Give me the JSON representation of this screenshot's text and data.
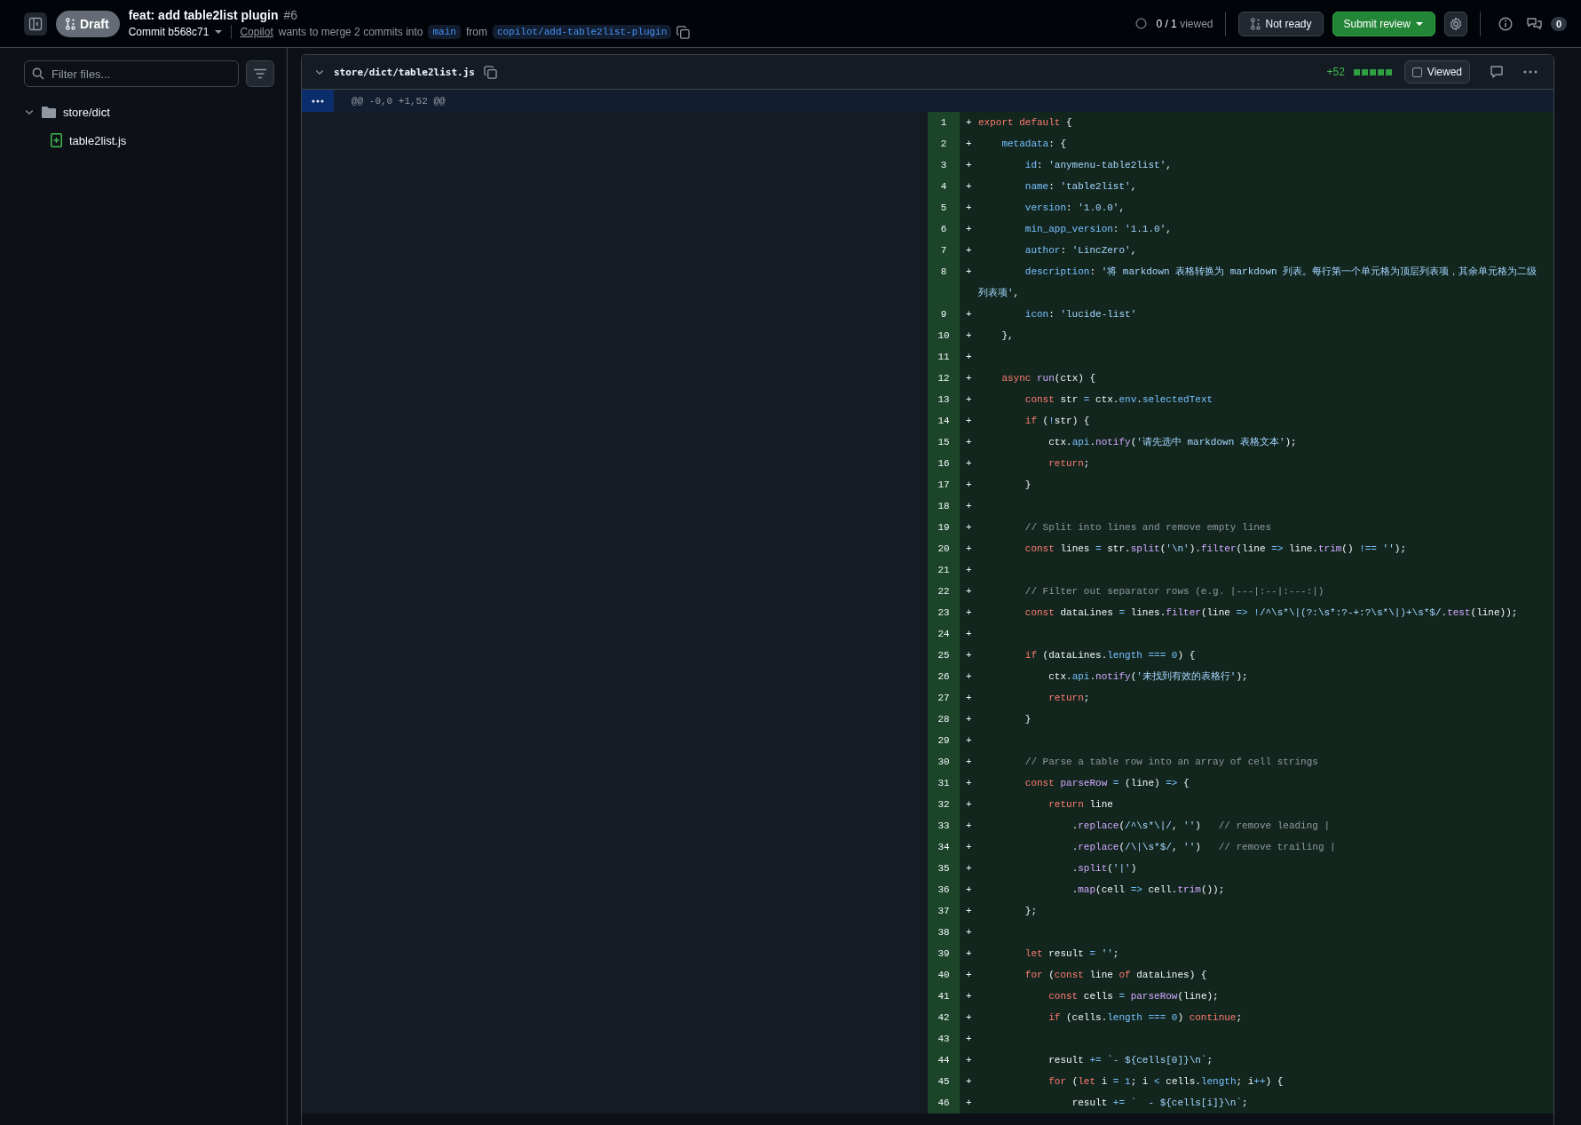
{
  "header": {
    "draft_label": "Draft",
    "title": "feat: add table2list plugin",
    "number": "#6",
    "commit": "Commit b568c71",
    "author": "Copilot",
    "merge_text": "wants to merge 2 commits into",
    "base_branch": "main",
    "from_text": "from",
    "head_branch": "copilot/add-table2list-plugin",
    "viewed_count": "0 / 1",
    "viewed_label": "viewed",
    "ready_button": "Not ready",
    "submit_button": "Submit review",
    "comment_count": "0"
  },
  "sidebar": {
    "filter": {
      "placeholder": "Filter files..."
    },
    "tree": [
      {
        "name": "store/dict",
        "kind": "folder",
        "expanded": true,
        "children": [
          {
            "name": "table2list.js",
            "kind": "added-file"
          }
        ]
      }
    ]
  },
  "file": {
    "path": "store/dict/table2list.js",
    "expanded": true,
    "additions": "+52",
    "viewed": {
      "label": "Viewed",
      "checked": false
    },
    "hunk": "@@ -0,0 +1,52 @@",
    "lines": [
      {
        "number": "1",
        "sign": "+",
        "tokens": [
          {
            "kind": "keyword",
            "text": "export default"
          },
          {
            "kind": "plain",
            "text": " {"
          }
        ]
      },
      {
        "number": "2",
        "sign": "+",
        "tokens": [
          {
            "kind": "property",
            "text": "    metadata"
          },
          {
            "kind": "plain",
            "text": ": {"
          }
        ]
      },
      {
        "number": "3",
        "sign": "+",
        "tokens": [
          {
            "kind": "property",
            "text": "        id"
          },
          {
            "kind": "plain",
            "text": ": "
          },
          {
            "kind": "string",
            "text": "'anymenu-table2list'"
          },
          {
            "kind": "plain",
            "text": ","
          }
        ]
      },
      {
        "number": "4",
        "sign": "+",
        "tokens": [
          {
            "kind": "property",
            "text": "        name"
          },
          {
            "kind": "plain",
            "text": ": "
          },
          {
            "kind": "string",
            "text": "'table2list'"
          },
          {
            "kind": "plain",
            "text": ","
          }
        ]
      },
      {
        "number": "5",
        "sign": "+",
        "tokens": [
          {
            "kind": "property",
            "text": "        version"
          },
          {
            "kind": "plain",
            "text": ": "
          },
          {
            "kind": "string",
            "text": "'1.0.0'"
          },
          {
            "kind": "plain",
            "text": ","
          }
        ]
      },
      {
        "number": "6",
        "sign": "+",
        "tokens": [
          {
            "kind": "property",
            "text": "        min_app_version"
          },
          {
            "kind": "plain",
            "text": ": "
          },
          {
            "kind": "string",
            "text": "'1.1.0'"
          },
          {
            "kind": "plain",
            "text": ","
          }
        ]
      },
      {
        "number": "7",
        "sign": "+",
        "tokens": [
          {
            "kind": "property",
            "text": "        author"
          },
          {
            "kind": "plain",
            "text": ": "
          },
          {
            "kind": "string",
            "text": "'LincZero'"
          },
          {
            "kind": "plain",
            "text": ","
          }
        ]
      },
      {
        "number": "8",
        "sign": "+",
        "tokens": [
          {
            "kind": "property",
            "text": "        description"
          },
          {
            "kind": "plain",
            "text": ": "
          },
          {
            "kind": "string",
            "text": "'将 markdown 表格转换为 markdown 列表。每行第一个单元格为顶层列表项，其余单元格为二级列表项'"
          },
          {
            "kind": "plain",
            "text": ","
          }
        ]
      },
      {
        "number": "9",
        "sign": "+",
        "tokens": [
          {
            "kind": "property",
            "text": "        icon"
          },
          {
            "kind": "plain",
            "text": ": "
          },
          {
            "kind": "string",
            "text": "'lucide-list'"
          }
        ]
      },
      {
        "number": "10",
        "sign": "+",
        "tokens": [
          {
            "kind": "plain",
            "text": "    },"
          }
        ]
      },
      {
        "number": "11",
        "sign": "+"
      },
      {
        "number": "12",
        "sign": "+",
        "tokens": [
          {
            "kind": "keyword",
            "text": "    async"
          },
          {
            "kind": "function",
            "text": " run"
          },
          {
            "kind": "plain",
            "text": "(ctx) {"
          }
        ]
      },
      {
        "number": "13",
        "sign": "+",
        "tokens": [
          {
            "kind": "keyword",
            "text": "        const"
          },
          {
            "kind": "plain",
            "text": " str "
          },
          {
            "kind": "property",
            "text": "="
          },
          {
            "kind": "plain",
            "text": " ctx."
          },
          {
            "kind": "property",
            "text": "env"
          },
          {
            "kind": "plain",
            "text": "."
          },
          {
            "kind": "property",
            "text": "selectedText"
          }
        ]
      },
      {
        "number": "14",
        "sign": "+",
        "tokens": [
          {
            "kind": "keyword",
            "text": "        if"
          },
          {
            "kind": "plain",
            "text": " ("
          },
          {
            "kind": "property",
            "text": "!"
          },
          {
            "kind": "plain",
            "text": "str) {"
          }
        ]
      },
      {
        "number": "15",
        "sign": "+",
        "tokens": [
          {
            "kind": "plain",
            "text": "            ctx."
          },
          {
            "kind": "property",
            "text": "api"
          },
          {
            "kind": "plain",
            "text": "."
          },
          {
            "kind": "function",
            "text": "notify"
          },
          {
            "kind": "plain",
            "text": "("
          },
          {
            "kind": "string",
            "text": "'请先选中 markdown 表格文本'"
          },
          {
            "kind": "plain",
            "text": ");"
          }
        ]
      },
      {
        "number": "16",
        "sign": "+",
        "tokens": [
          {
            "kind": "keyword",
            "text": "            return"
          },
          {
            "kind": "plain",
            "text": ";"
          }
        ]
      },
      {
        "number": "17",
        "sign": "+",
        "tokens": [
          {
            "kind": "plain",
            "text": "        }"
          }
        ]
      },
      {
        "number": "18",
        "sign": "+"
      },
      {
        "number": "19",
        "sign": "+",
        "tokens": [
          {
            "kind": "comment",
            "text": "        // Split into lines and remove empty lines"
          }
        ]
      },
      {
        "number": "20",
        "sign": "+",
        "tokens": [
          {
            "kind": "keyword",
            "text": "        const"
          },
          {
            "kind": "plain",
            "text": " lines "
          },
          {
            "kind": "property",
            "text": "="
          },
          {
            "kind": "plain",
            "text": " str."
          },
          {
            "kind": "function",
            "text": "split"
          },
          {
            "kind": "plain",
            "text": "("
          },
          {
            "kind": "string",
            "text": "'\\n'"
          },
          {
            "kind": "plain",
            "text": ")."
          },
          {
            "kind": "function",
            "text": "filter"
          },
          {
            "kind": "plain",
            "text": "(line "
          },
          {
            "kind": "property",
            "text": "=>"
          },
          {
            "kind": "plain",
            "text": " line."
          },
          {
            "kind": "function",
            "text": "trim"
          },
          {
            "kind": "plain",
            "text": "() "
          },
          {
            "kind": "property",
            "text": "!=="
          },
          {
            "kind": "string",
            "text": " ''"
          },
          {
            "kind": "plain",
            "text": ");"
          }
        ]
      },
      {
        "number": "21",
        "sign": "+"
      },
      {
        "number": "22",
        "sign": "+",
        "tokens": [
          {
            "kind": "comment",
            "text": "        // Filter out separator rows (e.g. |---|:--|:---:|)"
          }
        ]
      },
      {
        "number": "23",
        "sign": "+",
        "tokens": [
          {
            "kind": "keyword",
            "text": "        const"
          },
          {
            "kind": "plain",
            "text": " dataLines "
          },
          {
            "kind": "property",
            "text": "="
          },
          {
            "kind": "plain",
            "text": " lines."
          },
          {
            "kind": "function",
            "text": "filter"
          },
          {
            "kind": "plain",
            "text": "(line "
          },
          {
            "kind": "property",
            "text": "=>"
          },
          {
            "kind": "property",
            "text": " !"
          },
          {
            "kind": "string",
            "text": "/^\\s*\\|(?:\\s*:?-+:?\\s*\\|)+\\s*$/"
          },
          {
            "kind": "plain",
            "text": "."
          },
          {
            "kind": "function",
            "text": "test"
          },
          {
            "kind": "plain",
            "text": "(line));"
          }
        ]
      },
      {
        "number": "24",
        "sign": "+"
      },
      {
        "number": "25",
        "sign": "+",
        "tokens": [
          {
            "kind": "keyword",
            "text": "        if"
          },
          {
            "kind": "plain",
            "text": " (dataLines."
          },
          {
            "kind": "property",
            "text": "length"
          },
          {
            "kind": "property",
            "text": " ==="
          },
          {
            "kind": "property",
            "text": " 0"
          },
          {
            "kind": "plain",
            "text": ") {"
          }
        ]
      },
      {
        "number": "26",
        "sign": "+",
        "tokens": [
          {
            "kind": "plain",
            "text": "            ctx."
          },
          {
            "kind": "property",
            "text": "api"
          },
          {
            "kind": "plain",
            "text": "."
          },
          {
            "kind": "function",
            "text": "notify"
          },
          {
            "kind": "plain",
            "text": "("
          },
          {
            "kind": "string",
            "text": "'未找到有效的表格行'"
          },
          {
            "kind": "plain",
            "text": ");"
          }
        ]
      },
      {
        "number": "27",
        "sign": "+",
        "tokens": [
          {
            "kind": "keyword",
            "text": "            return"
          },
          {
            "kind": "plain",
            "text": ";"
          }
        ]
      },
      {
        "number": "28",
        "sign": "+",
        "tokens": [
          {
            "kind": "plain",
            "text": "        }"
          }
        ]
      },
      {
        "number": "29",
        "sign": "+"
      },
      {
        "number": "30",
        "sign": "+",
        "tokens": [
          {
            "kind": "comment",
            "text": "        // Parse a table row into an array of cell strings"
          }
        ]
      },
      {
        "number": "31",
        "sign": "+",
        "tokens": [
          {
            "kind": "keyword",
            "text": "        const"
          },
          {
            "kind": "function",
            "text": " parseRow"
          },
          {
            "kind": "property",
            "text": " ="
          },
          {
            "kind": "plain",
            "text": " (line) "
          },
          {
            "kind": "property",
            "text": "=>"
          },
          {
            "kind": "plain",
            "text": " {"
          }
        ]
      },
      {
        "number": "32",
        "sign": "+",
        "tokens": [
          {
            "kind": "keyword",
            "text": "            return"
          },
          {
            "kind": "plain",
            "text": " line"
          }
        ]
      },
      {
        "number": "33",
        "sign": "+",
        "tokens": [
          {
            "kind": "plain",
            "text": "                ."
          },
          {
            "kind": "function",
            "text": "replace"
          },
          {
            "kind": "plain",
            "text": "("
          },
          {
            "kind": "string",
            "text": "/^\\s*\\|/"
          },
          {
            "kind": "plain",
            "text": ", "
          },
          {
            "kind": "string",
            "text": "''"
          },
          {
            "kind": "plain",
            "text": ")"
          },
          {
            "kind": "comment",
            "text": "   // remove leading |"
          }
        ]
      },
      {
        "number": "34",
        "sign": "+",
        "tokens": [
          {
            "kind": "plain",
            "text": "                ."
          },
          {
            "kind": "function",
            "text": "replace"
          },
          {
            "kind": "plain",
            "text": "("
          },
          {
            "kind": "string",
            "text": "/\\|\\s*$/"
          },
          {
            "kind": "plain",
            "text": ", "
          },
          {
            "kind": "string",
            "text": "''"
          },
          {
            "kind": "plain",
            "text": ")"
          },
          {
            "kind": "comment",
            "text": "   // remove trailing |"
          }
        ]
      },
      {
        "number": "35",
        "sign": "+",
        "tokens": [
          {
            "kind": "plain",
            "text": "                ."
          },
          {
            "kind": "function",
            "text": "split"
          },
          {
            "kind": "plain",
            "text": "("
          },
          {
            "kind": "string",
            "text": "'|'"
          },
          {
            "kind": "plain",
            "text": ")"
          }
        ]
      },
      {
        "number": "36",
        "sign": "+",
        "tokens": [
          {
            "kind": "plain",
            "text": "                ."
          },
          {
            "kind": "function",
            "text": "map"
          },
          {
            "kind": "plain",
            "text": "(cell "
          },
          {
            "kind": "property",
            "text": "=>"
          },
          {
            "kind": "plain",
            "text": " cell."
          },
          {
            "kind": "function",
            "text": "trim"
          },
          {
            "kind": "plain",
            "text": "());"
          }
        ]
      },
      {
        "number": "37",
        "sign": "+",
        "tokens": [
          {
            "kind": "plain",
            "text": "        };"
          }
        ]
      },
      {
        "number": "38",
        "sign": "+"
      },
      {
        "number": "39",
        "sign": "+",
        "tokens": [
          {
            "kind": "keyword",
            "text": "        let"
          },
          {
            "kind": "plain",
            "text": " result "
          },
          {
            "kind": "property",
            "text": "="
          },
          {
            "kind": "string",
            "text": " ''"
          },
          {
            "kind": "plain",
            "text": ";"
          }
        ]
      },
      {
        "number": "40",
        "sign": "+",
        "tokens": [
          {
            "kind": "keyword",
            "text": "        for"
          },
          {
            "kind": "plain",
            "text": " ("
          },
          {
            "kind": "keyword",
            "text": "const"
          },
          {
            "kind": "plain",
            "text": " line "
          },
          {
            "kind": "keyword",
            "text": "of"
          },
          {
            "kind": "plain",
            "text": " dataLines) {"
          }
        ]
      },
      {
        "number": "41",
        "sign": "+",
        "tokens": [
          {
            "kind": "keyword",
            "text": "            const"
          },
          {
            "kind": "plain",
            "text": " cells "
          },
          {
            "kind": "property",
            "text": "="
          },
          {
            "kind": "function",
            "text": " parseRow"
          },
          {
            "kind": "plain",
            "text": "(line);"
          }
        ]
      },
      {
        "number": "42",
        "sign": "+",
        "tokens": [
          {
            "kind": "keyword",
            "text": "            if"
          },
          {
            "kind": "plain",
            "text": " (cells."
          },
          {
            "kind": "property",
            "text": "length"
          },
          {
            "kind": "property",
            "text": " ==="
          },
          {
            "kind": "property",
            "text": " 0"
          },
          {
            "kind": "plain",
            "text": ") "
          },
          {
            "kind": "keyword",
            "text": "continue"
          },
          {
            "kind": "plain",
            "text": ";"
          }
        ]
      },
      {
        "number": "43",
        "sign": "+"
      },
      {
        "number": "44",
        "sign": "+",
        "tokens": [
          {
            "kind": "plain",
            "text": "            result "
          },
          {
            "kind": "property",
            "text": "+="
          },
          {
            "kind": "string",
            "text": " `- ${cells[0]}\\n`"
          },
          {
            "kind": "plain",
            "text": ";"
          }
        ]
      },
      {
        "number": "45",
        "sign": "+",
        "tokens": [
          {
            "kind": "keyword",
            "text": "            for"
          },
          {
            "kind": "plain",
            "text": " ("
          },
          {
            "kind": "keyword",
            "text": "let"
          },
          {
            "kind": "plain",
            "text": " i "
          },
          {
            "kind": "property",
            "text": "="
          },
          {
            "kind": "property",
            "text": " 1"
          },
          {
            "kind": "plain",
            "text": "; i "
          },
          {
            "kind": "property",
            "text": "<"
          },
          {
            "kind": "plain",
            "text": " cells."
          },
          {
            "kind": "property",
            "text": "length"
          },
          {
            "kind": "plain",
            "text": "; i"
          },
          {
            "kind": "property",
            "text": "++"
          },
          {
            "kind": "plain",
            "text": ") {"
          }
        ]
      },
      {
        "number": "46",
        "sign": "+",
        "tokens": [
          {
            "kind": "plain",
            "text": "                result "
          },
          {
            "kind": "property",
            "text": "+="
          },
          {
            "kind": "string",
            "text": " `  - ${cells[i]}\\n`"
          },
          {
            "kind": "plain",
            "text": ";"
          }
        ]
      }
    ]
  }
}
